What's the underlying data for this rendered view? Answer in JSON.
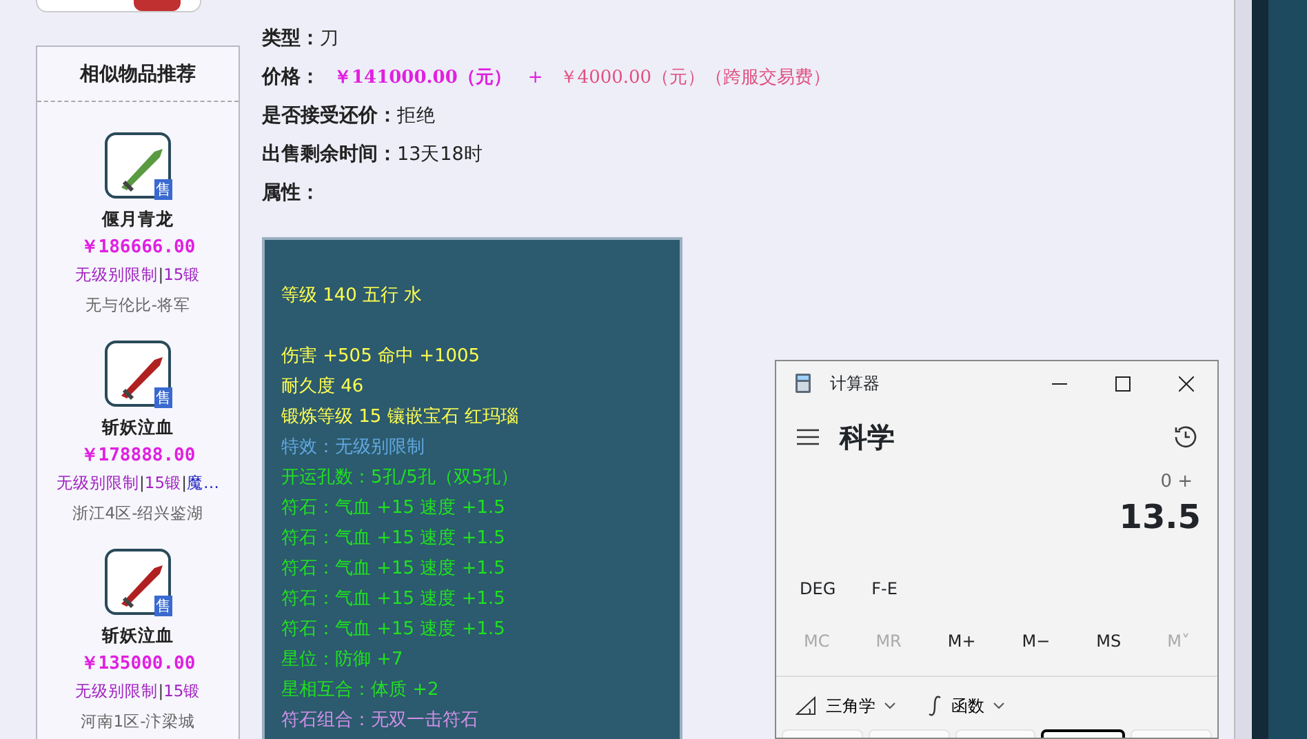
{
  "sidebar": {
    "title": "相似物品推荐",
    "items": [
      {
        "name": "偃月青龙",
        "color": "#5a9a40",
        "badge": "售",
        "price": "￥186666.00",
        "tags": [
          {
            "text": "无级别限制",
            "color": "#a020c0"
          },
          {
            "text": "|",
            "color": "#333333"
          },
          {
            "text": "15锻",
            "color": "#a020c0"
          }
        ],
        "server": "无与伦比-将军"
      },
      {
        "name": "斩妖泣血",
        "color": "#b02020",
        "badge": "售",
        "price": "￥178888.00",
        "tags": [
          {
            "text": "无级别限制",
            "color": "#a020c0"
          },
          {
            "text": "|",
            "color": "#333333"
          },
          {
            "text": "15锻",
            "color": "#a020c0"
          },
          {
            "text": "|",
            "color": "#333333"
          },
          {
            "text": "魔…",
            "color": "#2020c0"
          }
        ],
        "server": "浙江4区-绍兴鉴湖"
      },
      {
        "name": "斩妖泣血",
        "color": "#b02020",
        "badge": "售",
        "price": "￥135000.00",
        "tags": [
          {
            "text": "无级别限制",
            "color": "#a020c0"
          },
          {
            "text": "|",
            "color": "#333333"
          },
          {
            "text": "15锻",
            "color": "#a020c0"
          }
        ],
        "server": "河南1区-汴梁城"
      }
    ]
  },
  "details": [
    {
      "kind": "plain",
      "label": "类型：",
      "value": "刀"
    },
    {
      "kind": "price",
      "label": "价格：",
      "price": "￥141000.00（元）",
      "plus": "+",
      "fee": "￥4000.00（元）（跨服交易费）"
    },
    {
      "kind": "plain",
      "label": "是否接受还价：",
      "value": "拒绝"
    },
    {
      "kind": "plain",
      "label": "出售剩余时间：",
      "value": "13天18时"
    },
    {
      "kind": "plain",
      "label": "属性："
    }
  ],
  "attribute_groups": [
    [
      {
        "text": "等级 140 五行 水",
        "color": "#ffff50"
      }
    ],
    [
      {
        "text": "伤害 +505 命中 +1005",
        "color": "#ffff50"
      },
      {
        "text": "耐久度 46",
        "color": "#ffff50"
      },
      {
        "text": "锻炼等级 15 镶嵌宝石 红玛瑙",
        "color": "#ffff50"
      },
      {
        "text": "特效：无级别限制",
        "color": "#60a8e0"
      },
      {
        "text": "开运孔数：5孔/5孔（双5孔）",
        "color": "#20e020"
      },
      {
        "text": "符石：气血 +15 速度 +1.5",
        "color": "#20e020"
      },
      {
        "text": "符石：气血 +15 速度 +1.5",
        "color": "#20e020"
      },
      {
        "text": "符石：气血 +15 速度 +1.5",
        "color": "#20e020"
      },
      {
        "text": "符石：气血 +15 速度 +1.5",
        "color": "#20e020"
      },
      {
        "text": "符石：气血 +15 速度 +1.5",
        "color": "#20e020"
      },
      {
        "text": "星位：防御 +7",
        "color": "#20e020"
      },
      {
        "text": "星相互合：体质 +2",
        "color": "#20e020"
      },
      {
        "text": "符石组合：无双一击符石",
        "color": "#d090e8"
      }
    ]
  ],
  "calculator": {
    "title": "计算器",
    "mode": "科学",
    "expression": "0 +",
    "display": "13.5",
    "options": [
      "DEG",
      "F-E"
    ],
    "memory": [
      {
        "label": "MC",
        "disabled": true
      },
      {
        "label": "MR",
        "disabled": true
      },
      {
        "label": "M+",
        "disabled": false
      },
      {
        "label": "M−",
        "disabled": false
      },
      {
        "label": "MS",
        "disabled": false
      },
      {
        "label": "M˅",
        "disabled": true
      }
    ],
    "menus": [
      {
        "kind": "trig",
        "label": "三角学"
      },
      {
        "kind": "func",
        "label": "函数"
      }
    ]
  }
}
